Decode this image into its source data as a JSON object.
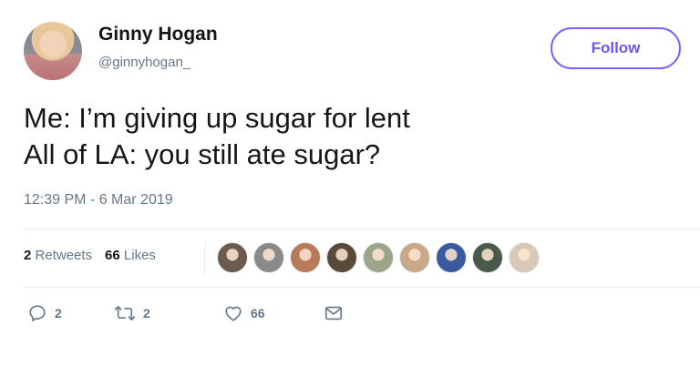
{
  "author": {
    "name": "Ginny Hogan",
    "handle": "@ginnyhogan_"
  },
  "follow_label": "Follow",
  "tweet": {
    "lines": [
      "Me: I’m giving up sugar for lent",
      "All of LA: you still ate sugar?"
    ],
    "timestamp": "12:39 PM - 6 Mar 2019"
  },
  "stats": {
    "retweets_count": "2",
    "retweets_label": "Retweets",
    "likes_count": "66",
    "likes_label": "Likes"
  },
  "liker_avatars": [
    "#6b5a4e",
    "#8a8a8a",
    "#b87a5a",
    "#5a4a3a",
    "#9aa58a",
    "#c9a88a",
    "#3a5aa0",
    "#4a5a4a",
    "#d8c8b8"
  ],
  "actions": {
    "reply_count": "2",
    "retweet_count": "2",
    "like_count": "66"
  },
  "colors": {
    "accent": "#7b61ff",
    "muted": "#657786",
    "text": "#14171a",
    "divider": "#e6ecf0"
  }
}
